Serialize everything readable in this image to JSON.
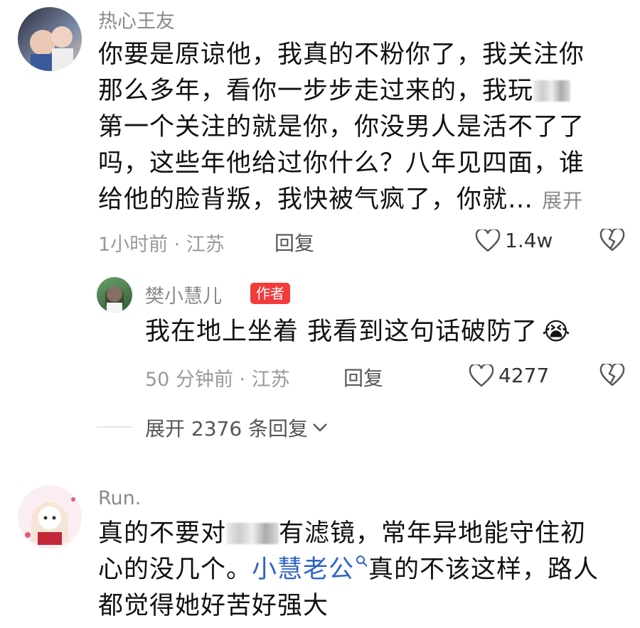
{
  "comment1": {
    "username": "热心王友",
    "lines": [
      "你要是原谅他，我真的不粉你了，我关注你",
      "那么多年，看你一步步走过来的，我玩",
      "第一个关注的就是你，你没男人是活不了了",
      "吗，这些年他给过你什么？八年见四面，谁",
      "给他的脸背叛，我快被气疯了，你就…"
    ],
    "expand_label": "展开",
    "time_location": "1小时前 · 江苏",
    "reply_label": "回复",
    "likes": "1.4w"
  },
  "reply1": {
    "username": "樊小慧儿",
    "badge": "作者",
    "text": "我在地上坐着  我看到这句话破防了",
    "emoji": "😭",
    "time_location": "50 分钟前 · 江苏",
    "reply_label": "回复",
    "likes": "4277"
  },
  "expand_replies": {
    "label": "展开 2376 条回复"
  },
  "comment2": {
    "username": "Run.",
    "line1_a": "真的不要对",
    "line1_b": "有滤镜，常年异地能守住初",
    "line2_a": "心的没几个。",
    "mention": "小慧老公",
    "line2_b": "真的不该这样，路人",
    "line3": "都觉得她好苦好强大"
  },
  "colors": {
    "accent_badge": "#f23b3b",
    "mention": "#2f63c8"
  }
}
